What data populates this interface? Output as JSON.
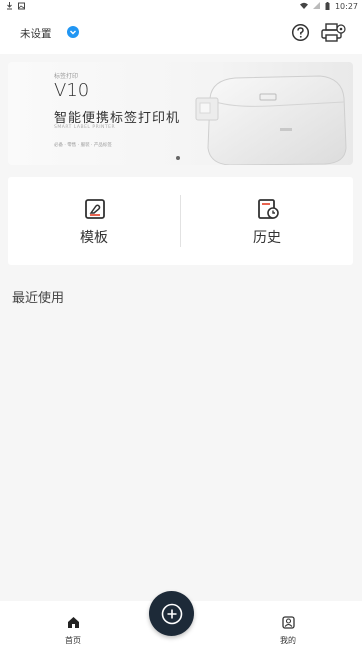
{
  "status_bar": {
    "time": "10:27",
    "icons": [
      "download-icon",
      "image-icon",
      "wifi-icon",
      "signal-icon",
      "battery-icon"
    ]
  },
  "header": {
    "device_label": "未设置",
    "icons": [
      "check-badge-icon",
      "help-icon",
      "printer-settings-icon"
    ]
  },
  "banner": {
    "subtitle": "标签打印",
    "model": "V10",
    "title": "智能便携标签打印机",
    "english": "SMART LABEL PRINTER",
    "features": "必备 · 零售 · 服装 · 产品标签"
  },
  "actions": [
    {
      "label": "模板",
      "icon": "template-icon"
    },
    {
      "label": "历史",
      "icon": "history-icon"
    }
  ],
  "recent": {
    "title": "最近使用"
  },
  "bottom_nav": {
    "home_label": "首页",
    "mine_label": "我的",
    "fab_icon": "add-icon"
  },
  "colors": {
    "accent": "#2196f3",
    "fab": "#1d2a38",
    "background": "#f6f6f6"
  }
}
